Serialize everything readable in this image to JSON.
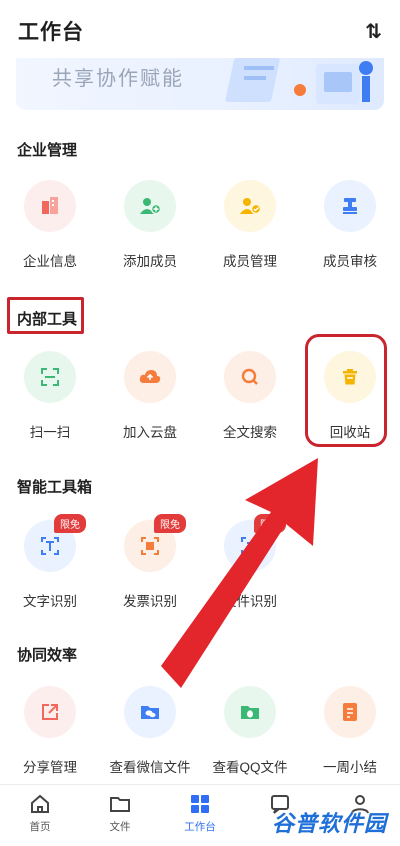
{
  "header": {
    "title": "工作台",
    "sort_icon": "sort-icon"
  },
  "banner": {
    "slogan": "共享协作赋能"
  },
  "sections": [
    {
      "title": "企业管理",
      "items": [
        {
          "label": "企业信息",
          "icon": "building-icon",
          "color": "#f2685c",
          "bg": "#fdeeee"
        },
        {
          "label": "添加成员",
          "icon": "add-user-icon",
          "color": "#3bb873",
          "bg": "#e8f7ee"
        },
        {
          "label": "成员管理",
          "icon": "manage-users-icon",
          "color": "#f4b400",
          "bg": "#fff6e0"
        },
        {
          "label": "成员审核",
          "icon": "stamp-icon",
          "color": "#3f7df3",
          "bg": "#eaf1ff"
        }
      ]
    },
    {
      "title": "内部工具",
      "items": [
        {
          "label": "扫一扫",
          "icon": "scan-icon",
          "color": "#3bb873",
          "bg": "#e8f7ee"
        },
        {
          "label": "加入云盘",
          "icon": "cloud-upload-icon",
          "color": "#f57c3a",
          "bg": "#fdeee6"
        },
        {
          "label": "全文搜索",
          "icon": "search-icon",
          "color": "#f57c3a",
          "bg": "#fdeee6"
        },
        {
          "label": "回收站",
          "icon": "trash-icon",
          "color": "#f4b400",
          "bg": "#fff6e0"
        }
      ]
    },
    {
      "title": "智能工具箱",
      "items": [
        {
          "label": "文字识别",
          "icon": "text-recognition-icon",
          "color": "#3f7df3",
          "bg": "#eaf1ff",
          "badge": "限免"
        },
        {
          "label": "发票识别",
          "icon": "invoice-recognition-icon",
          "color": "#f57c3a",
          "bg": "#fdeee6",
          "badge": "限免"
        },
        {
          "label": "文件识别",
          "icon": "file-recognition-icon",
          "color": "#3f7df3",
          "bg": "#eaf1ff",
          "badge": "限免"
        }
      ]
    },
    {
      "title": "协同效率",
      "items": [
        {
          "label": "分享管理",
          "icon": "share-icon",
          "color": "#f2685c",
          "bg": "#fdeeee"
        },
        {
          "label": "查看微信文件",
          "icon": "wechat-folder-icon",
          "color": "#3f7df3",
          "bg": "#eaf1ff"
        },
        {
          "label": "查看QQ文件",
          "icon": "qq-folder-icon",
          "color": "#3bb873",
          "bg": "#e8f7ee"
        },
        {
          "label": "一周小结",
          "icon": "summary-icon",
          "color": "#f57c3a",
          "bg": "#fdeee6"
        }
      ]
    }
  ],
  "tabbar": {
    "items": [
      {
        "label": "首页",
        "icon": "home-icon"
      },
      {
        "label": "文件",
        "icon": "folder-icon"
      },
      {
        "label": "工作台",
        "icon": "workbench-grid-icon",
        "active": true
      },
      {
        "label": "",
        "icon": "message-icon"
      },
      {
        "label": "",
        "icon": "profile-icon"
      }
    ]
  },
  "watermark": "谷普软件园",
  "colors": {
    "accent": "#2f6ef5",
    "highlight_red": "#c9252f",
    "arrow_red": "#e3262b"
  }
}
